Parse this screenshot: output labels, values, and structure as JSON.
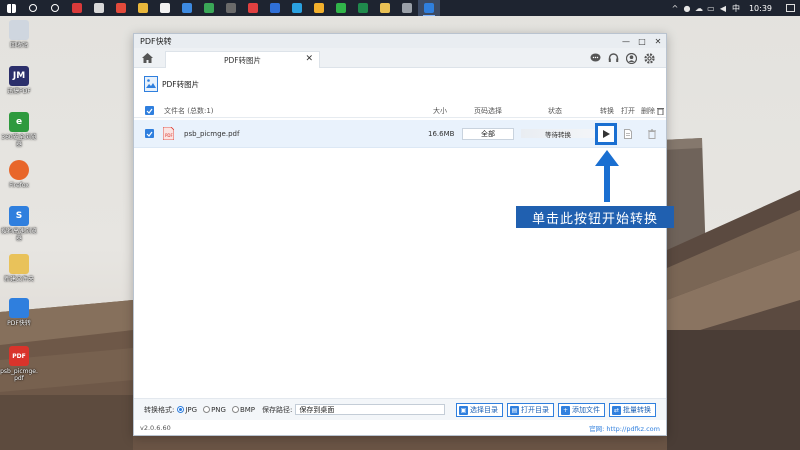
{
  "taskbar": {
    "icons": [
      "windows-logo-icon",
      "search-icon",
      "task-view-icon",
      "app-red",
      "app-photo",
      "app-pdf-red",
      "app-yellow",
      "app-file",
      "app-blue-arrow",
      "app-chrome",
      "app-camera",
      "app-red-camera",
      "app-blue",
      "app-shot",
      "app-emoji",
      "app-wechat",
      "app-excel",
      "app-folder",
      "app-gray",
      "app-pdf-active"
    ],
    "tray_ime": "中",
    "tray_time": "10:39"
  },
  "desktop_icons": [
    {
      "label": "回收站",
      "icon": "recycle-bin-icon",
      "color": "#cfd6df"
    },
    {
      "label": "迅捷PDF",
      "icon": "jm-icon",
      "color": "#2b2f6b",
      "text": "JM"
    },
    {
      "label": "360安全浏览器",
      "icon": "ie-icon",
      "color": "#2e9a3e",
      "text": "e"
    },
    {
      "label": "Firefox",
      "icon": "firefox-icon",
      "color": "#e8662a"
    },
    {
      "label": "搜狗高速浏览器",
      "icon": "sogou-icon",
      "color": "#2f7fde",
      "text": "S"
    },
    {
      "label": "新建文件夹",
      "icon": "folder-icon",
      "color": "#e9c25a"
    },
    {
      "label": "PDF快转",
      "icon": "pdf-cloud-icon",
      "color": "#2f7fde"
    },
    {
      "label": "psb_picmge.pdf",
      "icon": "pdf-file-icon",
      "color": "#d9342b",
      "text": "PDF"
    }
  ],
  "window": {
    "title": "PDF快转",
    "tab_label": "PDF转图片",
    "section_title": "PDF转图片"
  },
  "table": {
    "headers": {
      "file": "文件名 (总数:1)",
      "size": "大小",
      "pages": "页码选择",
      "status": "状态",
      "convert": "转换",
      "open": "打开",
      "delete": "删除"
    },
    "rows": [
      {
        "name": "psb_picmge.pdf",
        "size": "16.6MB",
        "pages": "全部",
        "status": "等待转换"
      }
    ]
  },
  "bottom": {
    "format_label": "转换格式:",
    "formats": [
      "JPG",
      "PNG",
      "BMP"
    ],
    "selected_format": "JPG",
    "save_label": "保存路径:",
    "save_path": "保存到桌面",
    "buttons": {
      "choose_dir": "选择目录",
      "open_dir": "打开目录",
      "add_file": "添加文件",
      "batch_convert": "批量转换"
    }
  },
  "footer": {
    "version": "v2.0.6.60",
    "site": "官网: http://pdfkz.com"
  },
  "annotation": "单击此按钮开始转换",
  "colors": {
    "accent": "#2f7fde",
    "highlight": "#1a6fd1",
    "annotation_bg": "#2060b0"
  }
}
